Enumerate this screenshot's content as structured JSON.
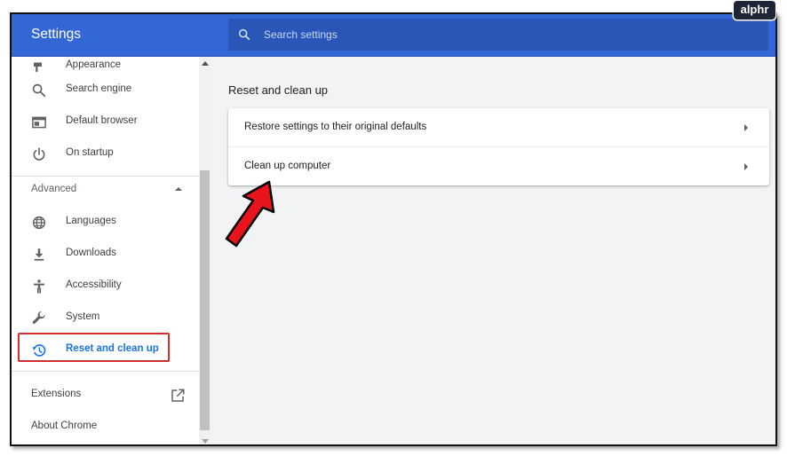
{
  "header": {
    "title": "Settings",
    "search_placeholder": "Search settings"
  },
  "sidebar": {
    "items_top": [
      {
        "label": "Appearance",
        "icon": "paintbrush-icon"
      },
      {
        "label": "Search engine",
        "icon": "search-icon"
      },
      {
        "label": "Default browser",
        "icon": "browser-window-icon"
      },
      {
        "label": "On startup",
        "icon": "power-icon"
      }
    ],
    "advanced_label": "Advanced",
    "items_advanced": [
      {
        "label": "Languages",
        "icon": "globe-icon"
      },
      {
        "label": "Downloads",
        "icon": "download-icon"
      },
      {
        "label": "Accessibility",
        "icon": "accessibility-icon"
      },
      {
        "label": "System",
        "icon": "wrench-icon"
      },
      {
        "label": "Reset and clean up",
        "icon": "restore-history-icon",
        "active": true
      }
    ],
    "extensions_label": "Extensions",
    "about_label": "About Chrome"
  },
  "main": {
    "heading": "Reset and clean up",
    "rows": [
      {
        "label": "Restore settings to their original defaults"
      },
      {
        "label": "Clean up computer"
      }
    ]
  },
  "watermark": "alphr",
  "colors": {
    "header_blue": "#3367d6",
    "active_blue": "#1a73e8",
    "highlight_red": "#d32f2f",
    "arrow_red": "#e8141c"
  }
}
